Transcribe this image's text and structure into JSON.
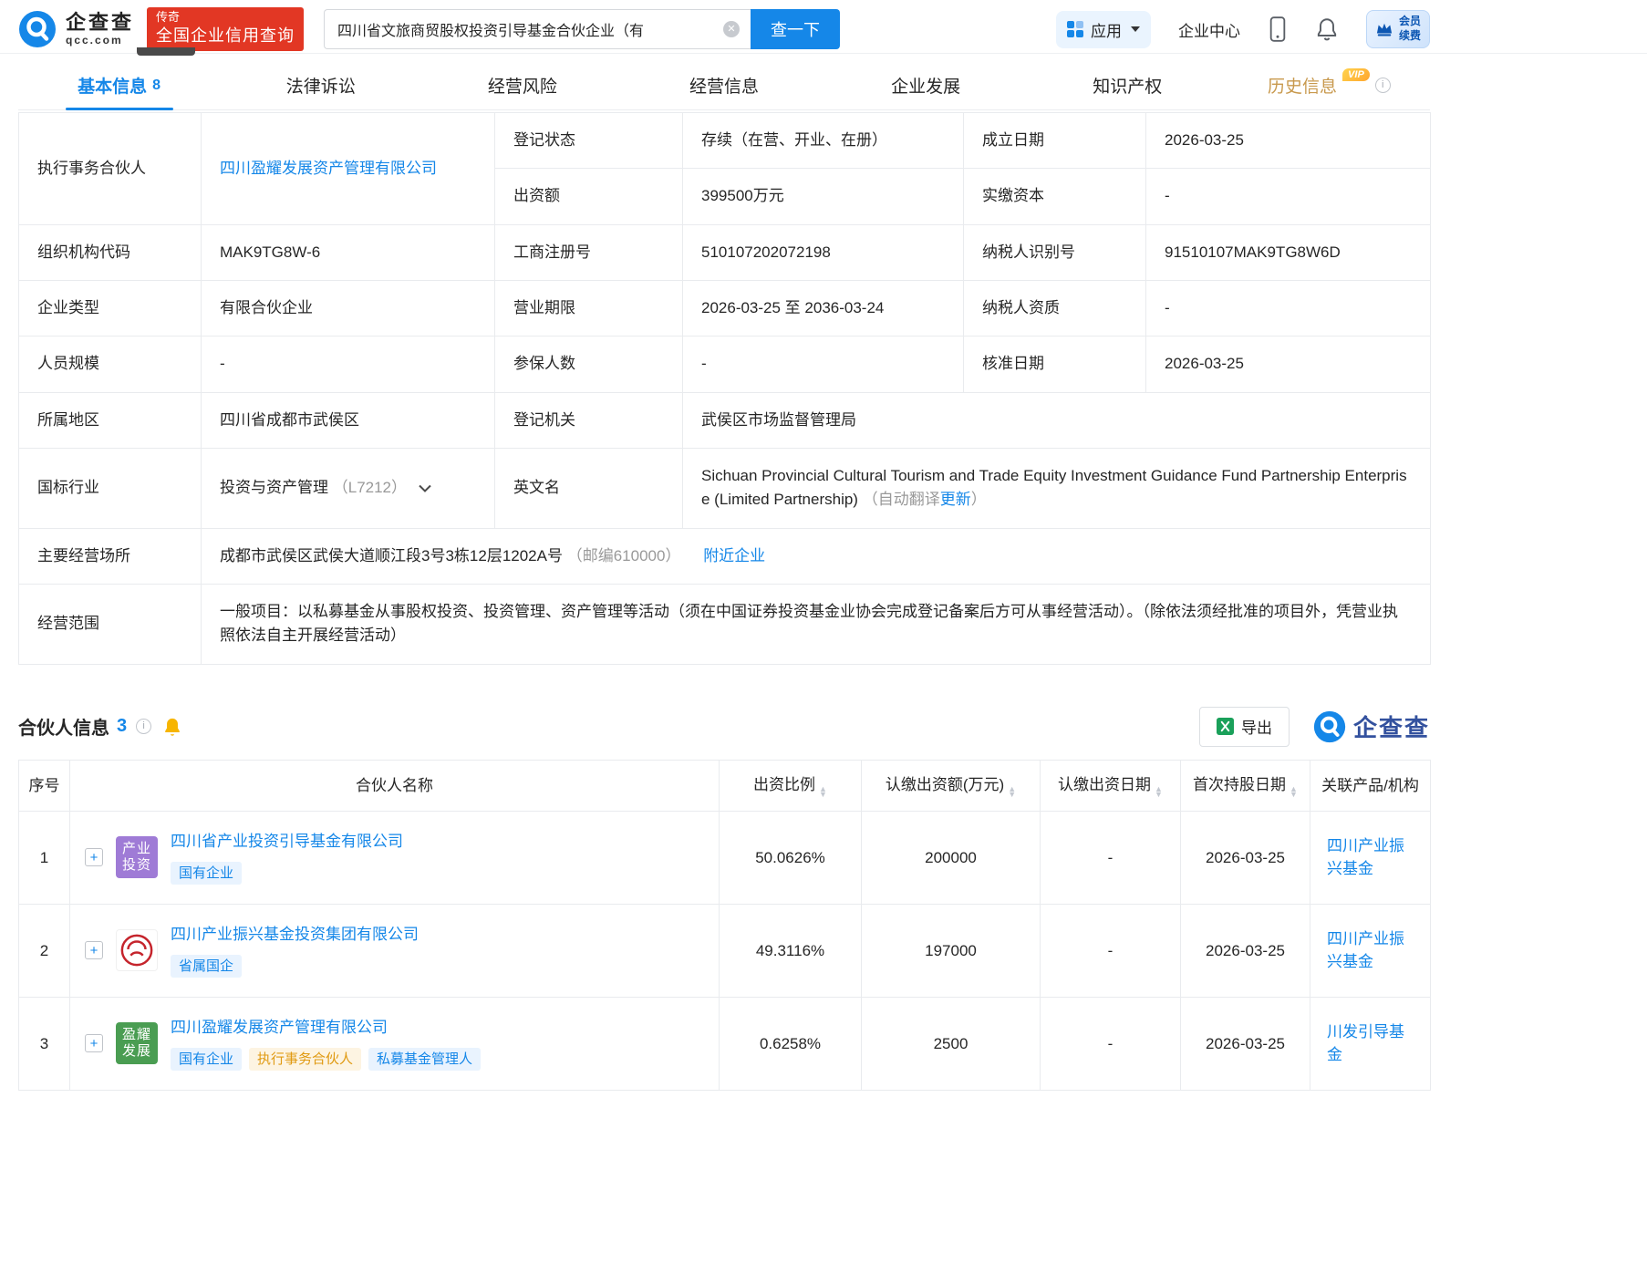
{
  "colors": {
    "brand_blue": "#1587e8",
    "promo_red": "#e23724",
    "vip_gold": "#ffa62e",
    "link_blue": "#1587e8",
    "badge_orange_text": "#e09a12",
    "logo_purple": "#9f7bd6",
    "logo_green": "#4a9d52",
    "emblem_red": "#c5242c"
  },
  "icons": {
    "clear": "✕",
    "expand": "+",
    "sort_up": "▲",
    "sort_down": "▼",
    "info": "i"
  },
  "header": {
    "brand": {
      "name": "企查查",
      "domain": "qcc.com"
    },
    "promo": {
      "line1": "传奇",
      "line2": "全国企业信用查询"
    },
    "search": {
      "value": "四川省文旅商贸股权投资引导基金合伙企业（有",
      "button_label": "查一下"
    },
    "nav": {
      "apps_label": "应用",
      "enterprise_center_label": "企业中心",
      "member_line1": "会员",
      "member_line2": "续费"
    }
  },
  "tabs": {
    "basic_label": "基本信息",
    "basic_count": "8",
    "legal_label": "法律诉讼",
    "risk_label": "经营风险",
    "operation_label": "经营信息",
    "development_label": "企业发展",
    "ip_label": "知识产权",
    "history_label": "历史信息",
    "history_vip": "VIP"
  },
  "basic_info": {
    "executive_partner_label": "执行事务合伙人",
    "executive_partner_value": "四川盈耀发展资产管理有限公司",
    "reg_status_label": "登记状态",
    "reg_status_value": "存续（在营、开业、在册）",
    "establish_date_label": "成立日期",
    "establish_date_value": "2026-03-25",
    "contribution_label": "出资额",
    "contribution_value": "399500万元",
    "paid_capital_label": "实缴资本",
    "paid_capital_value": "-",
    "org_code_label": "组织机构代码",
    "org_code_value": "MAK9TG8W-6",
    "reg_no_label": "工商注册号",
    "reg_no_value": "510107202072198",
    "taxpayer_id_label": "纳税人识别号",
    "taxpayer_id_value": "91510107MAK9TG8W6D",
    "company_type_label": "企业类型",
    "company_type_value": "有限合伙企业",
    "business_term_label": "营业期限",
    "business_term_value": "2026-03-25 至 2036-03-24",
    "taxpayer_quality_label": "纳税人资质",
    "taxpayer_quality_value": "-",
    "staff_size_label": "人员规模",
    "staff_size_value": "-",
    "insured_label": "参保人数",
    "insured_value": "-",
    "approval_date_label": "核准日期",
    "approval_date_value": "2026-03-25",
    "region_label": "所属地区",
    "region_value": "四川省成都市武侯区",
    "reg_authority_label": "登记机关",
    "reg_authority_value": "武侯区市场监督管理局",
    "industry_label": "国标行业",
    "industry_value": "投资与资产管理",
    "industry_code": "（L7212）",
    "english_name_label": "英文名",
    "english_name_value": "Sichuan Provincial Cultural Tourism and Trade Equity Investment Guidance Fund Partnership Enterprise (Limited Partnership)",
    "english_note_prefix": "（自动翻译",
    "english_update_link": "更新",
    "english_note_suffix": "）",
    "address_label": "主要经营场所",
    "address_value": "成都市武侯区武侯大道顺江段3号3栋12层1202A号",
    "address_postcode": "（邮编610000）",
    "nearby_link": "附近企业",
    "business_scope_label": "经营范围",
    "business_scope_value": "一般项目：以私募基金从事股权投资、投资管理、资产管理等活动（须在中国证券投资基金业协会完成登记备案后方可从事经营活动）。（除依法须经批准的项目外，凭营业执照依法自主开展经营活动）"
  },
  "partners": {
    "section_title": "合伙人信息",
    "count": "3",
    "export_label": "导出",
    "watermark": "企查查",
    "columns": {
      "index": "序号",
      "name": "合伙人名称",
      "ratio": "出资比例",
      "amount": "认缴出资额(万元)",
      "pay_date": "认缴出资日期",
      "first_date": "首次持股日期",
      "related": "关联产品/机构"
    },
    "rows": [
      {
        "index": "1",
        "logo_line1": "产业",
        "logo_line2": "投资",
        "name": "四川省产业投资引导基金有限公司",
        "badges": [
          "国有企业"
        ],
        "ratio": "50.0626%",
        "amount": "200000",
        "pay_date": "-",
        "first_date": "2026-03-25",
        "related": "四川产业振兴基金"
      },
      {
        "index": "2",
        "name": "四川产业振兴基金投资集团有限公司",
        "badges": [
          "省属国企"
        ],
        "ratio": "49.3116%",
        "amount": "197000",
        "pay_date": "-",
        "first_date": "2026-03-25",
        "related": "四川产业振兴基金"
      },
      {
        "index": "3",
        "logo_line1": "盈耀",
        "logo_line2": "发展",
        "name": "四川盈耀发展资产管理有限公司",
        "badges": [
          "国有企业",
          "执行事务合伙人",
          "私募基金管理人"
        ],
        "ratio": "0.6258%",
        "amount": "2500",
        "pay_date": "-",
        "first_date": "2026-03-25",
        "related": "川发引导基金"
      }
    ]
  }
}
